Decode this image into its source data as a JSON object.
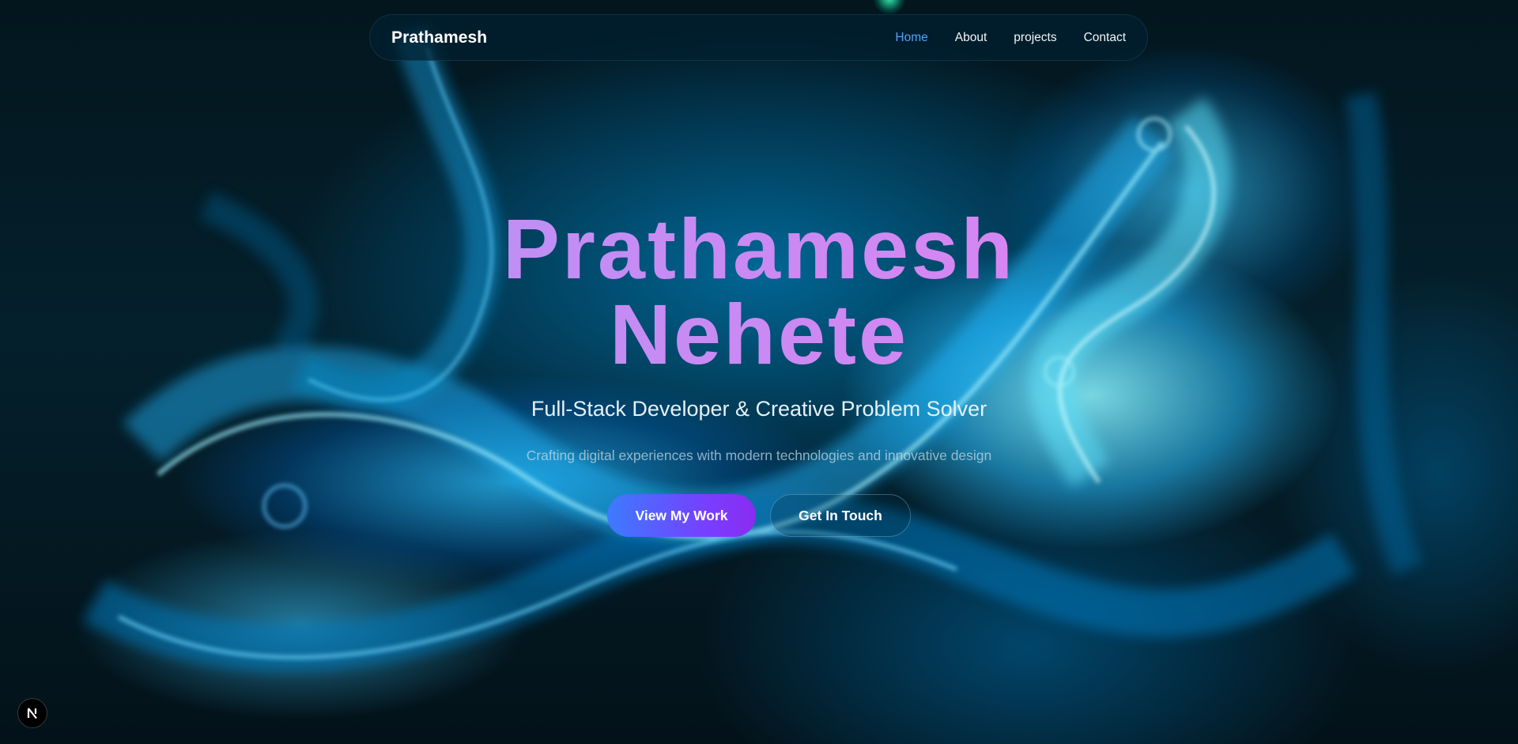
{
  "navbar": {
    "brand": "Prathamesh",
    "links": [
      {
        "label": "Home",
        "active": true
      },
      {
        "label": "About",
        "active": false
      },
      {
        "label": "projects",
        "active": false
      },
      {
        "label": "Contact",
        "active": false
      }
    ]
  },
  "hero": {
    "name_line1": "Prathamesh",
    "name_line2": "Nehete",
    "subtitle": "Full-Stack Developer & Creative Problem Solver",
    "tagline": "Crafting digital experiences with modern technologies and innovative design",
    "primary_button": "View My Work",
    "secondary_button": "Get In Touch"
  },
  "dev_indicator": {
    "icon": "nextjs-logo-icon"
  },
  "colors": {
    "active_link": "#4ea3ff",
    "name_gradient_start": "#a99af7",
    "name_gradient_end": "#ee7ef0",
    "primary_button_start": "#3c7bff",
    "primary_button_end": "#8a2cf0"
  }
}
